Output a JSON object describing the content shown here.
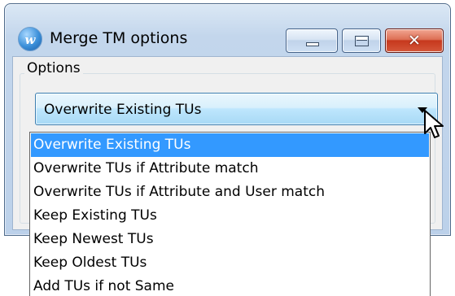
{
  "window": {
    "title": "Merge TM options",
    "icon": "app-logo-icon",
    "app_icon_letter": "w",
    "minimize_icon": "minimize-icon",
    "maximize_icon": "maximize-icon",
    "close_glyph": "✕",
    "close_color": "#c6381d"
  },
  "options_group": {
    "label": "Options",
    "combo": {
      "selected_value": "Overwrite Existing TUs",
      "arrow_icon": "chevron-down-icon"
    }
  },
  "dropdown": {
    "highlight_color": "#3399ff",
    "items": [
      {
        "label": "Overwrite Existing TUs",
        "selected": true
      },
      {
        "label": "Overwrite TUs if Attribute match",
        "selected": false
      },
      {
        "label": "Overwrite TUs if Attribute and User match",
        "selected": false
      },
      {
        "label": "Keep Existing TUs",
        "selected": false
      },
      {
        "label": "Keep Newest TUs",
        "selected": false
      },
      {
        "label": "Keep Oldest TUs",
        "selected": false
      },
      {
        "label": "Add TUs if not Same",
        "selected": false
      }
    ]
  },
  "cursor": {
    "icon": "mouse-pointer-icon"
  }
}
